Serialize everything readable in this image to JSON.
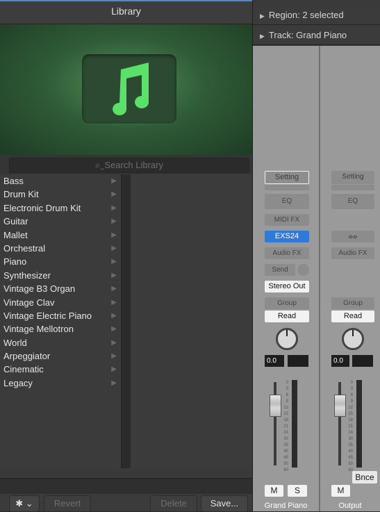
{
  "library": {
    "title": "Library",
    "search_placeholder": "Search Library",
    "categories": [
      "Bass",
      "Drum Kit",
      "Electronic Drum Kit",
      "Guitar",
      "Mallet",
      "Orchestral",
      "Piano",
      "Synthesizer",
      "Vintage B3 Organ",
      "Vintage Clav",
      "Vintage Electric Piano",
      "Vintage Mellotron",
      "World",
      "Arpeggiator",
      "Cinematic",
      "Legacy"
    ],
    "footer": {
      "revert": "Revert",
      "delete": "Delete",
      "save": "Save..."
    }
  },
  "inspector": {
    "region": "Region: 2 selected",
    "track": "Track:  Grand Piano"
  },
  "strips": {
    "left": {
      "setting": "Setting",
      "eq": "EQ",
      "midi_fx": "MIDI FX",
      "instrument": "EXS24",
      "audio_fx": "Audio FX",
      "send": "Send",
      "output": "Stereo Out",
      "group": "Group",
      "automation": "Read",
      "volume": "0.0",
      "mute": "M",
      "solo": "S",
      "name": "Grand Piano"
    },
    "right": {
      "setting": "Setting",
      "eq": "EQ",
      "link": "ⴰⴰ",
      "audio_fx": "Audio FX",
      "group": "Group",
      "automation": "Read",
      "volume": "0.0",
      "mute": "M",
      "bounce": "Bnce",
      "name": "Output"
    },
    "scale": [
      "0",
      "3",
      "6",
      "9",
      "12",
      "15",
      "18",
      "21",
      "24",
      "30",
      "35",
      "40",
      "45",
      "50",
      "60"
    ]
  }
}
